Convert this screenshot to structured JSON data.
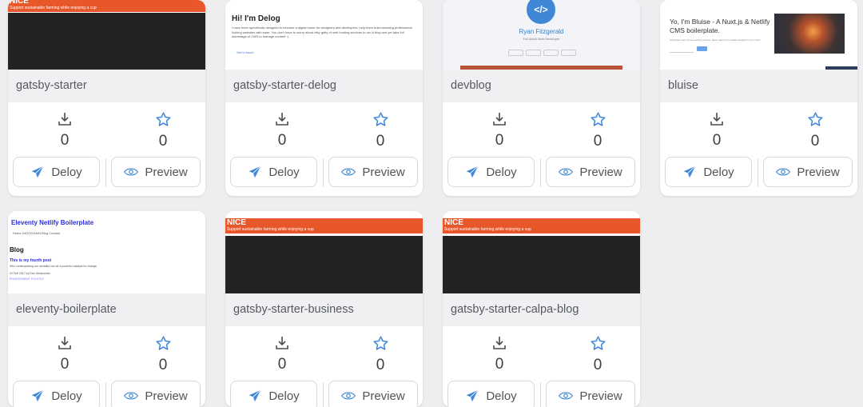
{
  "buttons": {
    "deploy_label": "Deloy",
    "preview_label": "Preview"
  },
  "colors": {
    "accent": "#3e88d7",
    "nice_orange": "#e8572a",
    "nice_dark": "#222324"
  },
  "thumbs": {
    "nice": {
      "title": "NICE",
      "tagline": "Support sustainable farming while enjoying a cup"
    },
    "delog": {
      "heading": "Hi! I'm Delog",
      "body": "I have been specifically designed to become a digital home for designers and developers, help them build amazing professional looking websites with ease. You don't have to worry about nitty gritty of web hosting services to run a blog and yet take full advantage of CMS to manage content :)",
      "link": "Get in touch"
    },
    "devblog": {
      "icon": "</>",
      "name": "Ryan Fitzgerald",
      "subtitle": "Full-stack Web Developer"
    },
    "bluise": {
      "title": "Yo, I'm Bluise - A Nuxt.js & Netlify CMS boilerplate.",
      "body": "Subscribe and receive exciting articles, latest news and updates straight to your inbox"
    },
    "eleventy": {
      "title": "Eleventy Netlify Boilerplate",
      "nav": "Home   DATOCHAIN   Blog   Contact",
      "blog": "Blog",
      "post": "This is my fourth post",
      "line1": "Why contemplating our mortality can be a powerful catalyst for change",
      "line2": "03 Feb 2017 by Dan Urbanowicz",
      "line3": "ENVIRONMENT    POLITICS"
    }
  },
  "cards": [
    {
      "name": "gatsby-starter",
      "downloads": "0",
      "stars": "0"
    },
    {
      "name": "gatsby-starter-delog",
      "downloads": "0",
      "stars": "0"
    },
    {
      "name": "devblog",
      "downloads": "0",
      "stars": "0"
    },
    {
      "name": "bluise",
      "downloads": "0",
      "stars": "0"
    },
    {
      "name": "eleventy-boilerplate",
      "downloads": "0",
      "stars": "0"
    },
    {
      "name": "gatsby-starter-business",
      "downloads": "0",
      "stars": "0"
    },
    {
      "name": "gatsby-starter-calpa-blog",
      "downloads": "0",
      "stars": "0"
    }
  ]
}
